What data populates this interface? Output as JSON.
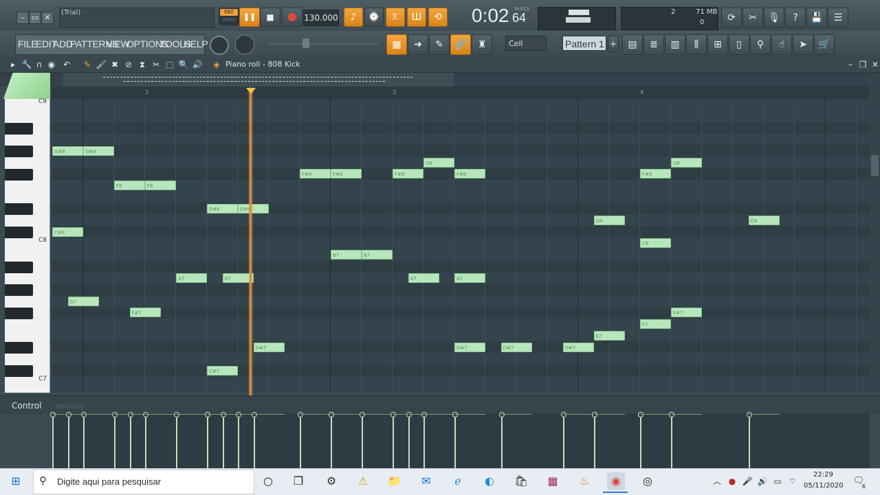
{
  "title_bar": {
    "trial": "(Trial)",
    "pat_label": "PAT",
    "song_label": "SONG",
    "tempo": "130.000",
    "time_main": "0:02",
    "time_sub": "64",
    "time_unit": "M:S:CS",
    "cpu_value": "2",
    "mem_value": "71 MB",
    "voices": "0"
  },
  "menu": {
    "items": [
      "FILE",
      "EDIT",
      "ADD",
      "PATTERNS",
      "VIEW",
      "OPTIONS",
      "TOOLS",
      "HELP"
    ],
    "snap": "Cell",
    "pattern": "Pattern 1"
  },
  "piano_roll": {
    "title": "Piano roll - 808 Kick"
  },
  "ruler": {
    "bars": [
      "2",
      "3",
      "4"
    ]
  },
  "keyboard": {
    "labels": [
      "C9",
      "C8",
      "C7"
    ]
  },
  "notes": [
    {
      "label": "G#8",
      "pitch": 104,
      "start": 0.0,
      "len": 0.5
    },
    {
      "label": "G#8",
      "pitch": 104,
      "start": 0.5,
      "len": 0.5
    },
    {
      "label": "F8",
      "pitch": 101,
      "start": 1.0,
      "len": 0.5
    },
    {
      "label": "F8",
      "pitch": 101,
      "start": 1.5,
      "len": 0.5
    },
    {
      "label": "D#8",
      "pitch": 99,
      "start": 2.5,
      "len": 0.5
    },
    {
      "label": "D#8",
      "pitch": 99,
      "start": 3.0,
      "len": 0.5
    },
    {
      "label": "C#8",
      "pitch": 97,
      "start": 0.0,
      "len": 0.5
    },
    {
      "label": "G7",
      "pitch": 91,
      "start": 0.25,
      "len": 0.5
    },
    {
      "label": "F#7",
      "pitch": 90,
      "start": 1.25,
      "len": 0.5
    },
    {
      "label": "A7",
      "pitch": 93,
      "start": 2.0,
      "len": 0.5
    },
    {
      "label": "A7",
      "pitch": 93,
      "start": 2.75,
      "len": 0.5
    },
    {
      "label": "C#7",
      "pitch": 85,
      "start": 2.5,
      "len": 0.5
    },
    {
      "label": "D#7",
      "pitch": 87,
      "start": 3.25,
      "len": 0.5
    },
    {
      "label": "F#8",
      "pitch": 102,
      "start": 4.0,
      "len": 0.5
    },
    {
      "label": "F#8",
      "pitch": 102,
      "start": 4.5,
      "len": 0.5
    },
    {
      "label": "B7",
      "pitch": 95,
      "start": 4.5,
      "len": 0.5
    },
    {
      "label": "B7",
      "pitch": 95,
      "start": 5.0,
      "len": 0.5
    },
    {
      "label": "F#8",
      "pitch": 102,
      "start": 5.5,
      "len": 0.5
    },
    {
      "label": "G8",
      "pitch": 103,
      "start": 6.0,
      "len": 0.5
    },
    {
      "label": "F#8",
      "pitch": 102,
      "start": 6.5,
      "len": 0.5
    },
    {
      "label": "A7",
      "pitch": 93,
      "start": 5.75,
      "len": 0.5
    },
    {
      "label": "A7",
      "pitch": 93,
      "start": 6.5,
      "len": 0.5
    },
    {
      "label": "D#7",
      "pitch": 87,
      "start": 6.5,
      "len": 0.5
    },
    {
      "label": "D#7",
      "pitch": 87,
      "start": 7.25,
      "len": 0.5
    },
    {
      "label": "D#7",
      "pitch": 87,
      "start": 8.25,
      "len": 0.5
    },
    {
      "label": "E7",
      "pitch": 88,
      "start": 8.75,
      "len": 0.5
    },
    {
      "label": "D8",
      "pitch": 98,
      "start": 8.75,
      "len": 0.5
    },
    {
      "label": "C8",
      "pitch": 96,
      "start": 9.5,
      "len": 0.5
    },
    {
      "label": "F#8",
      "pitch": 102,
      "start": 9.5,
      "len": 0.5
    },
    {
      "label": "F7",
      "pitch": 89,
      "start": 9.5,
      "len": 0.5
    },
    {
      "label": "G8",
      "pitch": 103,
      "start": 10.0,
      "len": 0.5
    },
    {
      "label": "F#7",
      "pitch": 90,
      "start": 10.0,
      "len": 0.5
    },
    {
      "label": "D8",
      "pitch": 98,
      "start": 11.25,
      "len": 0.5
    }
  ],
  "control": {
    "label": "Control",
    "param": "Velocity"
  },
  "taskbar": {
    "search_placeholder": "Digite aqui para pesquisar",
    "time": "22:29",
    "date": "05/11/2020",
    "notif_count": "6"
  }
}
